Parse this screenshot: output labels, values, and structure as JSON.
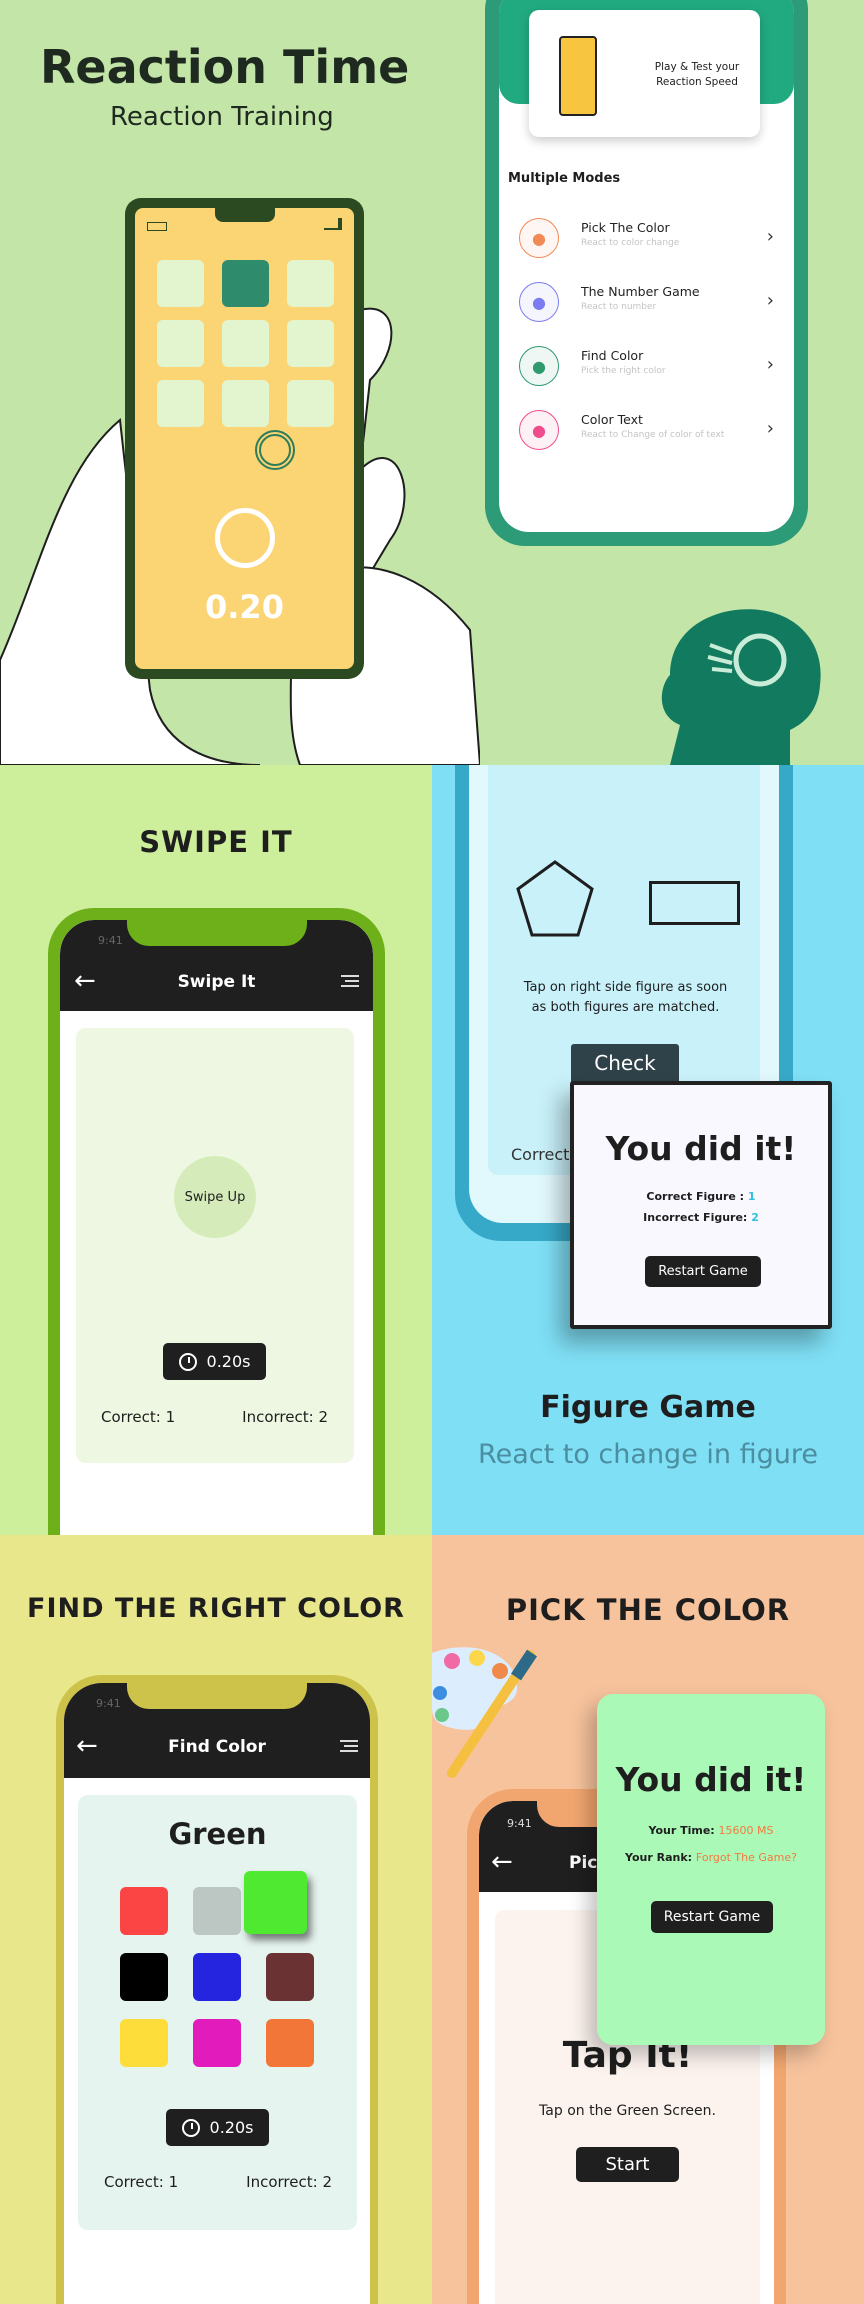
{
  "hero": {
    "title": "Reaction Time",
    "subtitle": "Reaction Training",
    "timer_value": "0.20",
    "home": {
      "card_text": "Play & Test your Reaction Speed",
      "section_title": "Multiple Modes",
      "modes": [
        {
          "title": "Pick The Color",
          "subtitle": "React to color change",
          "icon": "paint-bucket-icon",
          "color": "#f28a55"
        },
        {
          "title": "The Number Game",
          "subtitle": "React to number",
          "icon": "number-hexagons-icon",
          "color": "#7b7cf0"
        },
        {
          "title": "Find Color",
          "subtitle": "Pick the right color",
          "icon": "eyedropper-icon",
          "color": "#2e9a6d"
        },
        {
          "title": "Color Text",
          "subtitle": "React to Change of color of text",
          "icon": "text-color-icon",
          "color": "#ef4c8d"
        }
      ]
    }
  },
  "swipe": {
    "heading": "SWIPE IT",
    "status_time": "9:41",
    "header_title": "Swipe It",
    "circle_label": "Swipe Up",
    "timer": "0.20s",
    "correct": "Correct: 1",
    "incorrect": "Incorrect: 2"
  },
  "figure": {
    "instruction": "Tap on right side figure as soon as both figures are matched.",
    "check_label": "Check",
    "behind_correct": "Correct",
    "dialog": {
      "title": "You did it!",
      "correct_label": "Correct Figure :",
      "correct_value": "1",
      "incorrect_label": "Incorrect Figure:",
      "incorrect_value": "2",
      "restart_label": "Restart Game"
    },
    "caption_title": "Figure Game",
    "caption_subtitle": "React to change in figure"
  },
  "find": {
    "heading": "FIND THE RIGHT COLOR",
    "status_time": "9:41",
    "header_title": "Find Color",
    "target_color": "Green",
    "swatches": [
      "#fb4444",
      "#bcc7c3",
      "#4ee930",
      "#000000",
      "#2525e0",
      "#6a3233",
      "#fddd3a",
      "#e21bbd",
      "#f27638"
    ],
    "timer": "0.20s",
    "correct": "Correct: 1",
    "incorrect": "Incorrect: 2"
  },
  "pick": {
    "heading": "PICK THE COLOR",
    "status_time": "9:41",
    "header_title": "Pick",
    "big_text": "Tap It!",
    "instruction": "Tap on the Green Screen.",
    "start_label": "Start",
    "dialog": {
      "title": "You did it!",
      "time_label": "Your Time:",
      "time_value": "15600 MS",
      "rank_label": "Your Rank:",
      "rank_value": "Forgot The Game?",
      "restart_label": "Restart Game"
    }
  }
}
